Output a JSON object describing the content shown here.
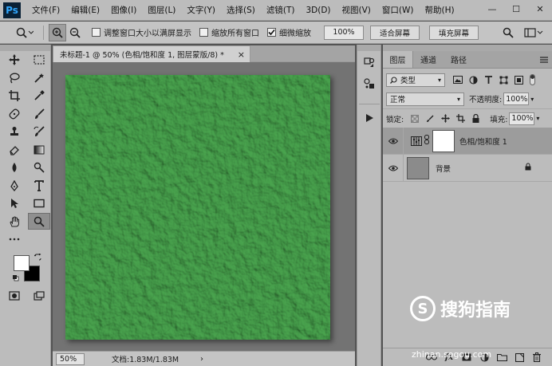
{
  "app": {
    "logo": "Ps"
  },
  "menu": [
    "文件(F)",
    "编辑(E)",
    "图像(I)",
    "图层(L)",
    "文字(Y)",
    "选择(S)",
    "滤镜(T)",
    "3D(D)",
    "视图(V)",
    "窗口(W)",
    "帮助(H)"
  ],
  "window_controls": {
    "minimize": "—",
    "maximize": "☐",
    "close": "✕"
  },
  "options": {
    "resize_windows": "调整窗口大小以满屏显示",
    "zoom_all": "缩放所有窗口",
    "scrubby_zoom": "细微缩放",
    "resize_checked": false,
    "zoom_all_checked": false,
    "scrubby_checked": true,
    "zoom_value": "100%",
    "fit_screen": "适合屏幕",
    "fill_screen": "填充屏幕"
  },
  "document": {
    "tab_title": "未标题-1 @ 50% (色相/饱和度 1, 图层蒙版/8) *",
    "close": "×",
    "canvas_color": "#49a44e",
    "zoom": "50%",
    "info": "文档:1.83M/1.83M",
    "arrow": "›"
  },
  "layers_panel": {
    "tabs": [
      "图层",
      "通道",
      "路径"
    ],
    "filter_kind": "类型",
    "blend_mode": "正常",
    "opacity_label": "不透明度:",
    "opacity": "100%",
    "lock_label": "锁定:",
    "fill_label": "填充:",
    "fill": "100%",
    "layers": [
      {
        "name": "色相/饱和度 1",
        "type": "adjustment",
        "selected": true
      },
      {
        "name": "背景",
        "type": "background",
        "selected": false
      }
    ]
  },
  "watermark": {
    "logo_letter": "S",
    "text": "搜狗指南",
    "url": "zhinan.sogou.com"
  }
}
